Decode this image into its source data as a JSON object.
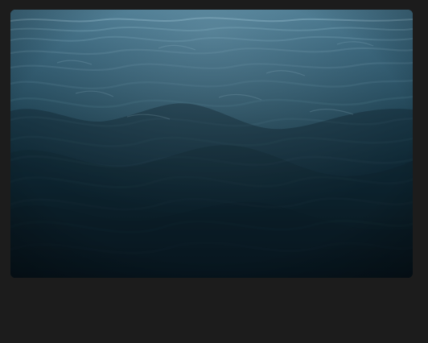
{
  "image": {
    "subject": "",
    "colors": {
      "background": "#1c1c1c",
      "water_highlight": "#6f9db3",
      "water_mid": "#1f4458",
      "water_dark": "#07131b"
    }
  }
}
